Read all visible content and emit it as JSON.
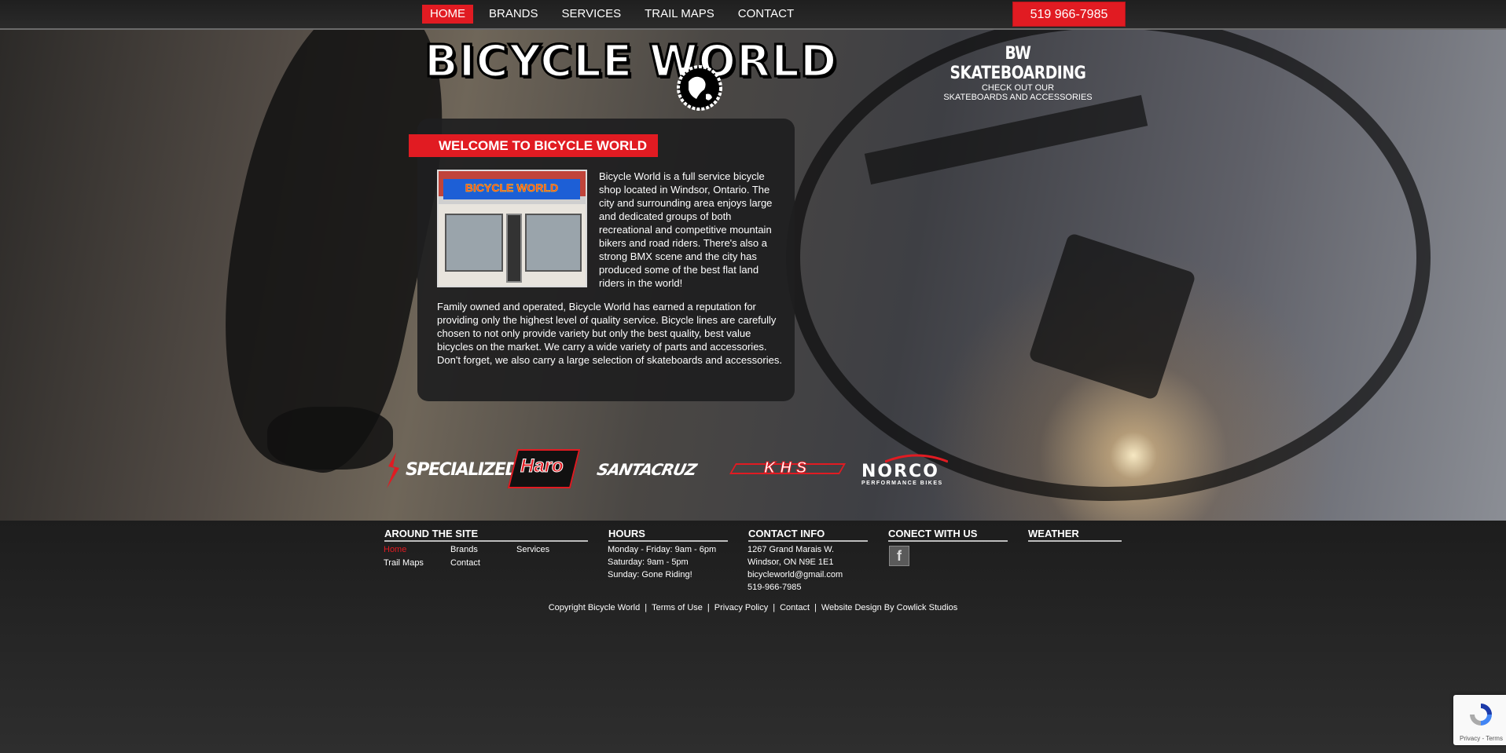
{
  "nav": {
    "items": [
      {
        "label": "HOME",
        "active": true
      },
      {
        "label": "BRANDS"
      },
      {
        "label": "SERVICES"
      },
      {
        "label": "TRAIL MAPS"
      },
      {
        "label": "CONTACT"
      }
    ],
    "phone": "519 966-7985"
  },
  "header": {
    "logo_text": "BICYCLE WORLD",
    "skateboarding": {
      "title": "BW SKATEBOARDING",
      "subtitle_line1": "CHECK OUT OUR",
      "subtitle_line2": "SKATEBOARDS AND ACCESSORIES"
    }
  },
  "welcome": {
    "title": "WELCOME TO BICYCLE WORLD",
    "photo_sign": "BICYCLE WORLD",
    "intro": "Bicycle World is a full service bicycle shop located in Windsor, Ontario. The city and surrounding area enjoys large and dedicated groups of both recreational and competitive mountain bikers and road riders. There's also a strong BMX scene and the city has produced some of the best flat land riders in the world!",
    "body": "Family owned and operated, Bicycle World has earned a reputation for providing only the highest level of quality service. Bicycle lines are carefully chosen to not only provide variety but only the best quality, best value bicycles on the market. We carry a wide variety of parts and accessories. Don't forget, we also carry a large selection of skateboards and accessories."
  },
  "brands": {
    "specialized": "SPECIALIZED",
    "haro": "Haro",
    "santacruz": "SANTACRUZ",
    "khs": "KHS",
    "norco": "NORCO",
    "norco_sub": "PERFORMANCE BIKES"
  },
  "footer": {
    "around": {
      "heading": "AROUND THE SITE",
      "links": [
        "Home",
        "Brands",
        "Services",
        "Trail Maps",
        "Contact"
      ]
    },
    "hours": {
      "heading": "HOURS",
      "lines": [
        "Monday - Friday: 9am - 6pm",
        "Saturday: 9am - 5pm",
        "Sunday: Gone Riding!"
      ]
    },
    "contact": {
      "heading": "CONTACT INFO",
      "lines": [
        "1267 Grand Marais W.",
        "Windsor, ON N9E 1E1",
        "bicycleworld@gmail.com",
        "519-966-7985"
      ]
    },
    "connect": {
      "heading": "CONECT WITH US",
      "facebook": "f"
    },
    "weather": {
      "heading": "WEATHER"
    },
    "copyright": [
      "Copyright Bicycle World",
      "Terms of Use",
      "Privacy Policy",
      "Contact",
      "Website Design By Cowlick Studios"
    ]
  },
  "recaptcha": {
    "text": "Privacy - Terms"
  },
  "colors": {
    "accent": "#e11b22",
    "active_link": "#e11b22"
  }
}
